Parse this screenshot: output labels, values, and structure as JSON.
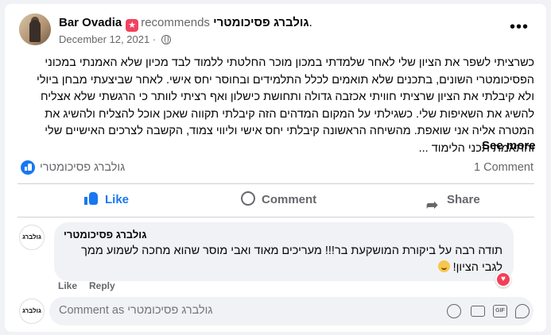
{
  "post": {
    "author": "Bar Ovadia",
    "recommends_word": "recommends",
    "page_name": "גולברג פסיכומטרי",
    "page_name_suffix": ".",
    "date": "December 12, 2021 ·",
    "body": "כשרציתי לשפר את הציון שלי לאחר שלמדתי במכון מוכר החלטתי ללמוד לבד מכיון שלא האמנתי במכוני הפסיכומטרי השונים, בתכנים שלא תואמים לכלל התלמידים ובחוסר יחס אישי. לאחר שביצעתי מבחן ביולי ולא קיבלתי את הציון שרציתי חוויתי אכזבה גדולה ותחושת כישלון ואף רציתי לוותר כי הרגשתי שלא אצליח להשיג את השאיפות שלי. כשגילתי על המקום המדהים הזה קיבלתי תקווה שאכן אוכל להצליח ולהשיג את המטרה אליה אני שואפת. מהשיחה הראשונה קיבלתי יחס אישי וליווי צמוד, הקשבה לצרכים האישיים שלי והתאמת תכני הלימוד ...",
    "see_more": "See more"
  },
  "stats": {
    "reaction_names": "גולברג פסיכומטרי",
    "comment_count": "1 Comment"
  },
  "actions": {
    "like": "Like",
    "comment": "Comment",
    "share": "Share"
  },
  "comment": {
    "avatar_text": "גולברג",
    "author": "גולברג פסיכומטרי",
    "text": "תודה רבה על ביקורת המושקעת בר!!! מעריכים מאוד ואבי מוסר שהוא מחכה לשמוע ממך לגבי הציון!",
    "like": "Like",
    "reply": "Reply"
  },
  "composer": {
    "avatar_text": "גולברג",
    "placeholder": "Comment as גולברג פסיכומטרי"
  },
  "colors": {
    "accent": "#1877f2",
    "recommend": "#f3425f",
    "heart": "#f33e58",
    "muted": "#65676b"
  }
}
